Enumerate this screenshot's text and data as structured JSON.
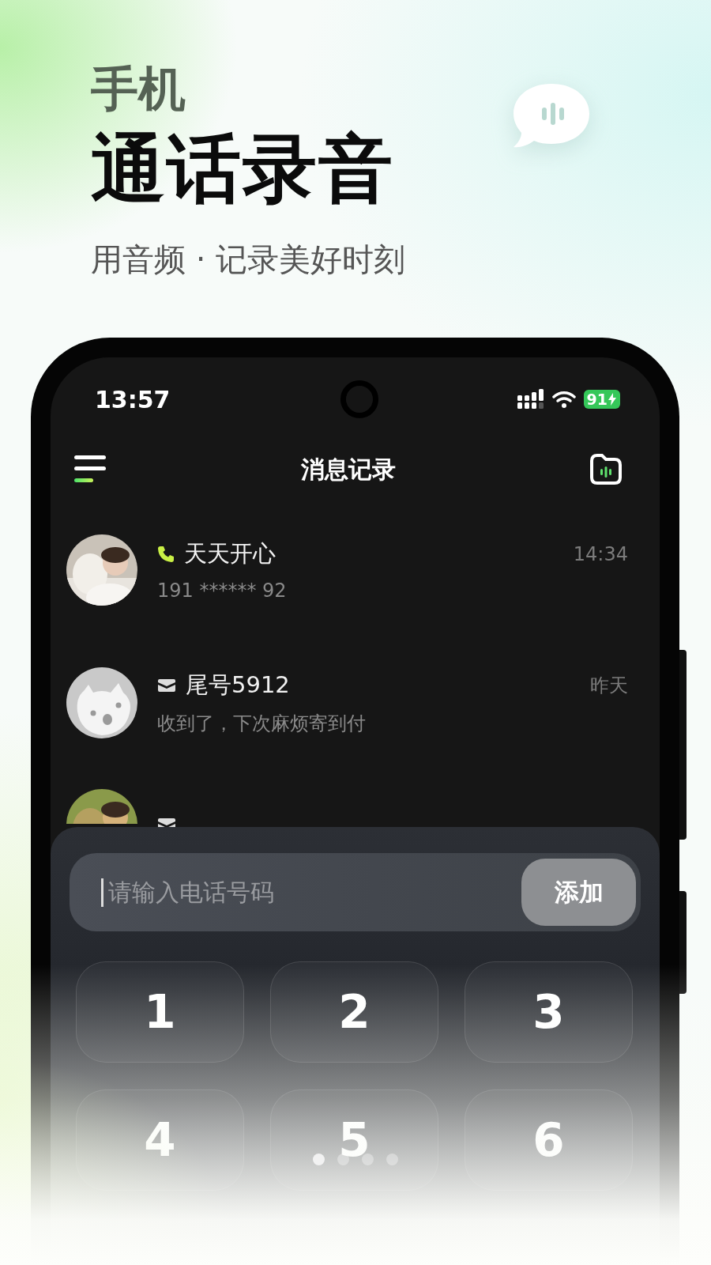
{
  "hero": {
    "title_small": "手机",
    "title_large": "通话录音",
    "subtitle": "用音频 · 记录美好时刻"
  },
  "status_bar": {
    "time": "13:57",
    "battery": "91"
  },
  "nav": {
    "title": "消息记录"
  },
  "messages": [
    {
      "kind": "call",
      "name": "天天开心",
      "time": "14:34",
      "preview": "191 ****** 92"
    },
    {
      "kind": "sms",
      "avatar": {
        "kind": "icon"
      },
      "name": "尾号5912",
      "time": "昨天",
      "preview": "收到了，下次麻烦寄到付"
    },
    {
      "kind": "sms"
    }
  ],
  "dialer": {
    "input": {
      "placeholder": "请输入电话号码"
    },
    "add_button": "添加",
    "keys": [
      "1",
      "2",
      "3",
      "4",
      "5",
      "6"
    ]
  },
  "page_dots": [
    {
      "selected": true
    },
    {
      "selected": false
    },
    {
      "selected": false
    },
    {
      "selected": false
    }
  ]
}
